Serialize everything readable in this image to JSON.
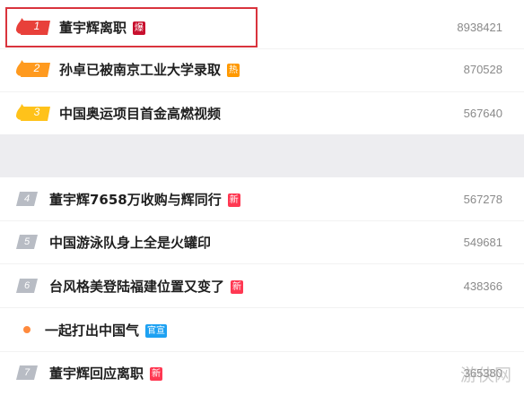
{
  "top_items": [
    {
      "rank": "1",
      "title": "董宇辉离职",
      "tag": "爆",
      "count": "8938421"
    },
    {
      "rank": "2",
      "title": "孙卓已被南京工业大学录取",
      "tag": "热",
      "count": "870528"
    },
    {
      "rank": "3",
      "title": "中国奥运项目首金高燃视频",
      "tag": "",
      "count": "567640"
    }
  ],
  "bottom_items": [
    {
      "rank": "4",
      "title": "董宇辉7658万收购与辉同行",
      "tag": "新",
      "count": "567278"
    },
    {
      "rank": "5",
      "title": "中国游泳队身上全是火罐印",
      "tag": "",
      "count": "549681"
    },
    {
      "rank": "6",
      "title": "台风格美登陆福建位置又变了",
      "tag": "新",
      "count": "438366"
    },
    {
      "rank": "",
      "title": "一起打出中国气",
      "tag": "官宣",
      "count": ""
    },
    {
      "rank": "7",
      "title": "董宇辉回应离职",
      "tag": "新",
      "count": "365380"
    }
  ],
  "watermark": "游侠网",
  "colors": {
    "flame_red": "#e8403a",
    "flame_orange": "#ff9a1f",
    "flame_yellow": "#ffc21a",
    "rank_grey": "#b8bcc4",
    "highlight_border": "#d9343d",
    "dot_orange": "#ff8a3d"
  },
  "icons": [
    "flame-icon",
    "promo-dot-icon"
  ]
}
